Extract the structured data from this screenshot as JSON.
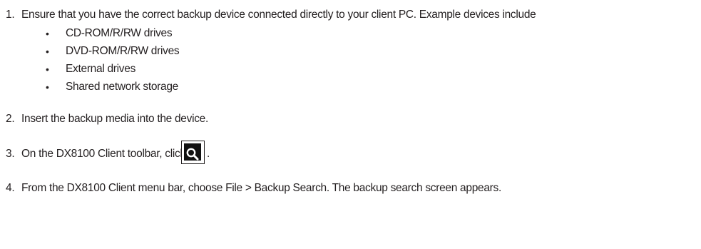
{
  "steps": [
    {
      "number": "1.",
      "text": "Ensure that you have the correct backup device connected directly to your client PC. Example devices include",
      "bullets": [
        "CD-ROM/R/RW drives",
        "DVD-ROM/R/RW drives",
        "External drives",
        "Shared network storage"
      ]
    },
    {
      "number": "2.",
      "text": "Insert the backup media into the device."
    },
    {
      "number": "3.",
      "text": "On the DX8100 Client toolbar, click",
      "trailing": "."
    },
    {
      "number": "4.",
      "text": "From the DX8100 Client menu bar, choose File > Backup Search. The backup search screen appears."
    }
  ],
  "bullet_glyph": "•",
  "icon": {
    "name": "backup-search-icon",
    "background": "#111111",
    "glyph_color": "#ffffff"
  }
}
